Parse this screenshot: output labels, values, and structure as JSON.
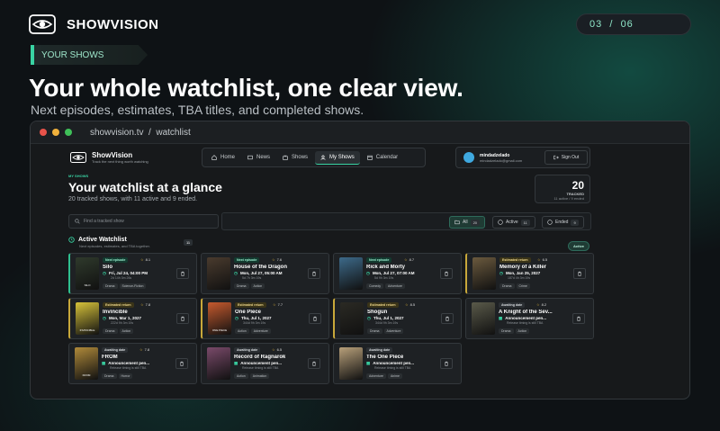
{
  "brand": {
    "name": "SHOWVISION"
  },
  "page_indicator": {
    "current": "03",
    "sep": "/",
    "total": "06"
  },
  "section_tag": "YOUR SHOWS",
  "headline": "Your whole watchlist, one clear view.",
  "subhead": "Next episodes, estimates, TBA titles, and completed shows.",
  "window": {
    "url_host": "showvision.tv",
    "url_sep": "/",
    "url_path": "watchlist",
    "dots": [
      "#e8534a",
      "#f0b13c",
      "#3fc059"
    ]
  },
  "app": {
    "logo_title": "ShowVision",
    "logo_tagline": "Track the next thing worth watching",
    "nav": [
      {
        "label": "Home",
        "icon": "home-icon"
      },
      {
        "label": "News",
        "icon": "news-icon"
      },
      {
        "label": "Shows",
        "icon": "tv-icon"
      },
      {
        "label": "My Shows",
        "icon": "user-icon",
        "active": true
      },
      {
        "label": "Calendar",
        "icon": "calendar-icon"
      }
    ],
    "user": {
      "name": "mindadzelado",
      "email": "mindadzelado@gmail.com",
      "signout": "Sign Out"
    },
    "eyebrow": "MY SHOWS",
    "title": "Your watchlist at a glance",
    "description": "20 tracked shows, with 11 active and 9 ended.",
    "count": {
      "number": "20",
      "label": "TRACKED",
      "sub": "11 active / 9 ended"
    },
    "search_placeholder": "Find a tracked show",
    "filters": [
      {
        "label": "All",
        "count": "20",
        "active": true
      },
      {
        "label": "Active",
        "count": "11"
      },
      {
        "label": "Ended",
        "count": "9"
      }
    ],
    "section": {
      "title": "Active Watchlist",
      "subtitle": "Next episodes, estimates, and TBA together.",
      "count": "11",
      "pill": "Active"
    },
    "cards": [
      {
        "badge": "Next episode",
        "kind": "next",
        "rating": "8.1",
        "title": "Silo",
        "date": "Fri, Jul 24, 04:00 PM",
        "meta": "2d 14h 3m 26s",
        "tags": [
          "Drama",
          "Science-Fiction"
        ],
        "poster": "#2f3a2c",
        "poster_text": "SILO",
        "accent": "green"
      },
      {
        "badge": "Next episode",
        "kind": "next",
        "rating": "7.6",
        "title": "House of the Dragon",
        "date": "Mon, Jul 27, 05:00 AM",
        "meta": "5d 7h 3m 19s",
        "tags": [
          "Drama",
          "Action"
        ],
        "poster": "#4a3b2e",
        "poster_text": "",
        "accent": "none"
      },
      {
        "badge": "Next episode",
        "kind": "next",
        "rating": "8.7",
        "title": "Rick and Morty",
        "date": "Mon, Jul 27, 07:00 AM",
        "meta": "5d 9h 3m 19s",
        "tags": [
          "Comedy",
          "Adventure"
        ],
        "poster": "#3d6a8a",
        "poster_text": "",
        "accent": "none"
      },
      {
        "badge": "Estimated return",
        "kind": "est",
        "rating": "6.5",
        "title": "Memory of a Killer",
        "date": "Mon, Jan 25, 2027",
        "meta": "187d 4h 3m 19s",
        "tags": [
          "Drama",
          "Crime"
        ],
        "poster": "#6b5a3e",
        "poster_text": "",
        "accent": "gold"
      },
      {
        "badge": "Estimated return",
        "kind": "est",
        "rating": "7.8",
        "title": "Invincible",
        "date": "Mon, Mar 1, 2027",
        "meta": "222d 9h 3m 19s",
        "tags": [
          "Drama",
          "Action"
        ],
        "poster": "#d6c23a",
        "poster_text": "INVINCIBLE",
        "accent": "gold"
      },
      {
        "badge": "Estimated return",
        "kind": "est",
        "rating": "7.7",
        "title": "One Piece",
        "date": "Thu, Jul 1, 2027",
        "meta": "344d 9h 3m 19s",
        "tags": [
          "Action",
          "Adventure"
        ],
        "poster": "#c65a2e",
        "poster_text": "ONE PIECE",
        "accent": "gold"
      },
      {
        "badge": "Estimated return",
        "kind": "est",
        "rating": "8.5",
        "title": "Shōgun",
        "date": "Thu, Jul 1, 2027",
        "meta": "344d 9h 3m 19s",
        "tags": [
          "Drama",
          "Adventure"
        ],
        "poster": "#2b2a24",
        "poster_text": "",
        "accent": "gold"
      },
      {
        "badge": "Awaiting date",
        "kind": "await",
        "rating": "8.2",
        "title": "A Knight of the Sev...",
        "date": "Announcement pen...",
        "meta": "Release timing is still TBA",
        "tags": [
          "Drama",
          "Action"
        ],
        "poster": "#5a5a4a",
        "poster_text": "",
        "accent": "none"
      },
      {
        "badge": "Awaiting date",
        "kind": "await",
        "rating": "7.8",
        "title": "FROM",
        "date": "Announcement pen...",
        "meta": "Release timing is still TBA",
        "tags": [
          "Drama",
          "Horror"
        ],
        "poster": "#b08a3a",
        "poster_text": "FROM",
        "accent": "none"
      },
      {
        "badge": "Awaiting date",
        "kind": "await",
        "rating": "6.5",
        "title": "Record of Ragnarok",
        "date": "Announcement pen...",
        "meta": "Release timing is still TBA",
        "tags": [
          "Action",
          "Animation"
        ],
        "poster": "#7a4a6a",
        "poster_text": "",
        "accent": "none"
      },
      {
        "badge": "Awaiting date",
        "kind": "await",
        "rating": "",
        "title": "The One Piece",
        "date": "Announcement pen...",
        "meta": "Release timing is still TBA",
        "tags": [
          "Adventure",
          "Anime"
        ],
        "poster": "#b8a07a",
        "poster_text": "",
        "accent": "none"
      }
    ]
  }
}
